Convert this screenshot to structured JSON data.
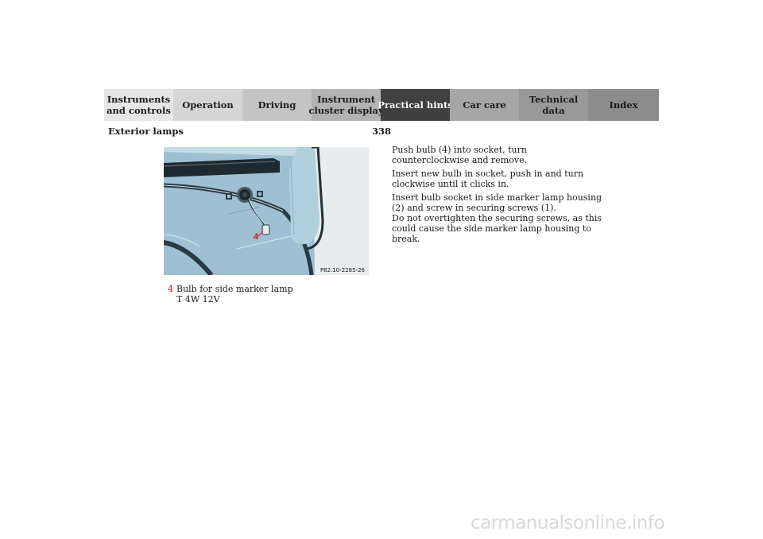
{
  "nav": {
    "tabs": [
      {
        "line1": "Instruments",
        "line2": "and controls",
        "bg": "#e6e6e6",
        "fg": "#1a1a1a",
        "active": false
      },
      {
        "line1": "Operation",
        "line2": "",
        "bg": "#d6d6d6",
        "fg": "#1a1a1a",
        "active": false
      },
      {
        "line1": "Driving",
        "line2": "",
        "bg": "#c4c4c4",
        "fg": "#1a1a1a",
        "active": false
      },
      {
        "line1": "Instrument",
        "line2": "cluster display",
        "bg": "#b3b3b3",
        "fg": "#1a1a1a",
        "active": false
      },
      {
        "line1": "Practical hints",
        "line2": "",
        "bg": "#404040",
        "fg": "#ffffff",
        "active": true
      },
      {
        "line1": "Car care",
        "line2": "",
        "bg": "#a6a6a6",
        "fg": "#1a1a1a",
        "active": false
      },
      {
        "line1": "Technical",
        "line2": "data",
        "bg": "#999999",
        "fg": "#1a1a1a",
        "active": false
      },
      {
        "line1": "Index",
        "line2": "",
        "bg": "#8c8c8c",
        "fg": "#1a1a1a",
        "active": false
      }
    ]
  },
  "header": {
    "page_number": "338",
    "section_title": "Exterior lamps"
  },
  "figure": {
    "code": "P82.10-2285-26",
    "callout": "4",
    "callout_color": "#d2141e",
    "vehicle_color": "#9ec0d2"
  },
  "caption": {
    "number": "4",
    "line1": "Bulb for side marker lamp",
    "line2": "T 4W 12V"
  },
  "instructions": [
    "Push bulb (4) into socket, turn counterclockwise and remove.",
    "Insert new bulb in socket, push in and turn clockwise until it clicks in.",
    "Insert bulb socket in side marker lamp housing (2) and screw in securing screws (1).",
    "Do not overtighten the securing screws, as this could cause the side marker lamp housing to break."
  ],
  "watermark": "carmanualsonline.info"
}
